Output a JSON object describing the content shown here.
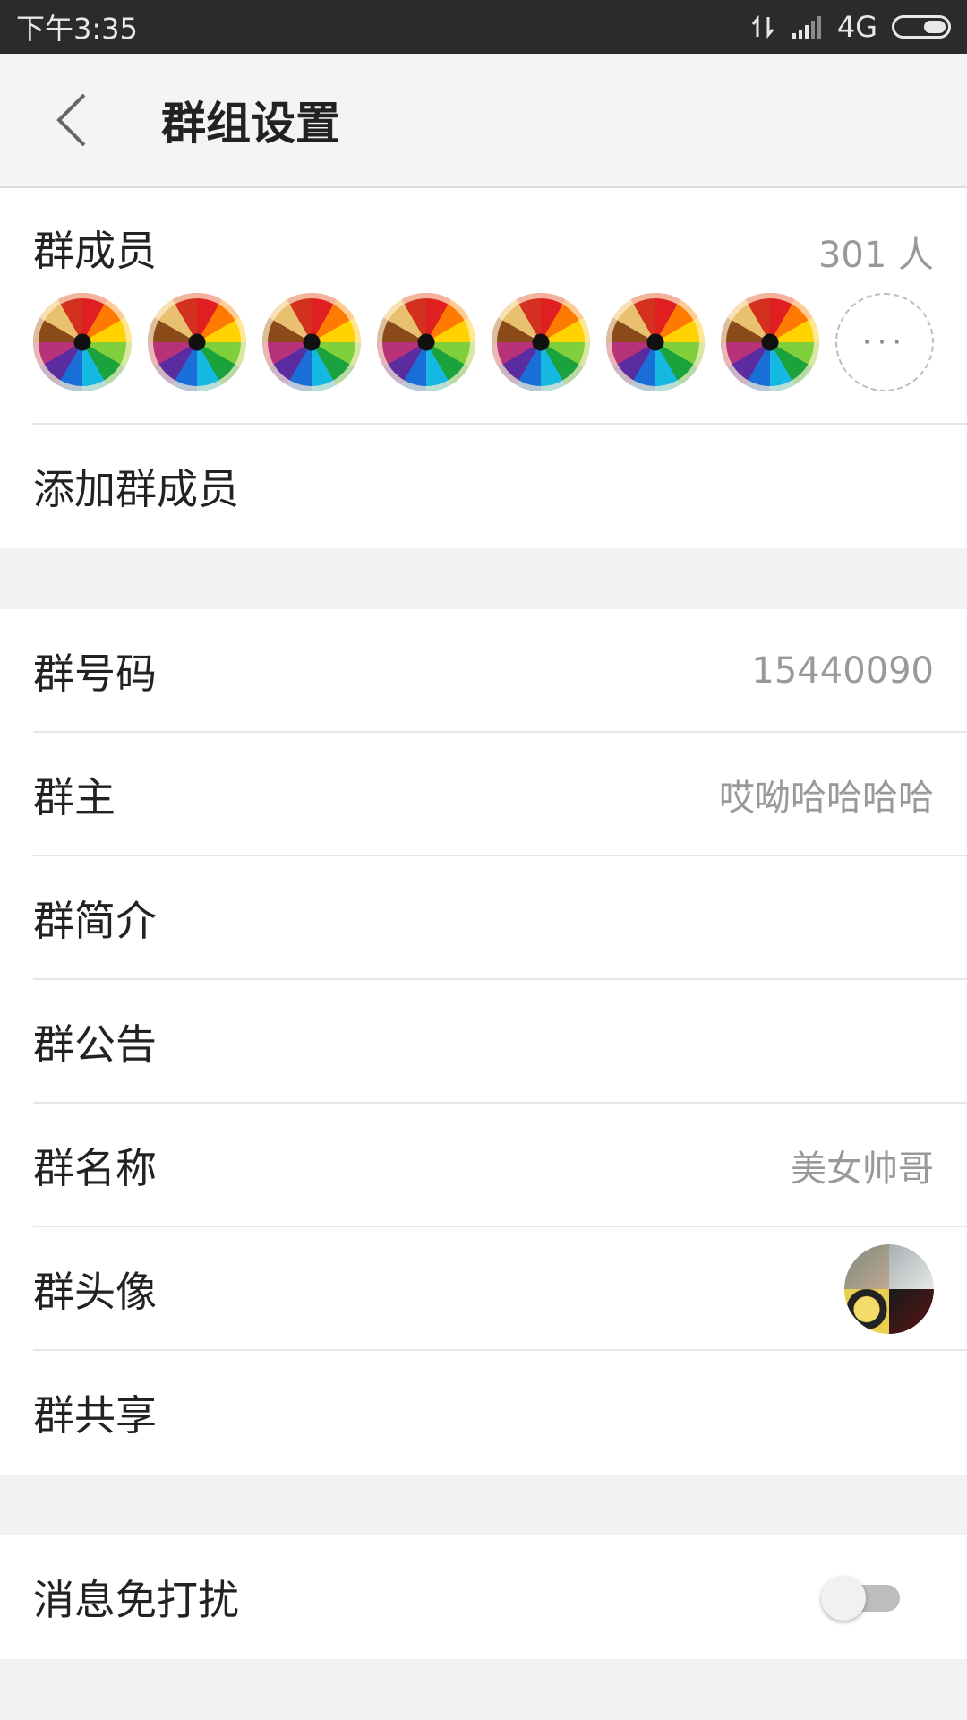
{
  "status_bar": {
    "time": "下午3:35",
    "network": "4G"
  },
  "header": {
    "title": "群组设置"
  },
  "members": {
    "label": "群成员",
    "count": "301 人",
    "avatar_count": 7,
    "more_label": "···"
  },
  "add_member": {
    "label": "添加群成员"
  },
  "info_rows": [
    {
      "label": "群号码",
      "value": "15440090"
    },
    {
      "label": "群主",
      "value": "哎呦哈哈哈哈"
    },
    {
      "label": "群简介",
      "value": ""
    },
    {
      "label": "群公告",
      "value": ""
    },
    {
      "label": "群名称",
      "value": "美女帅哥"
    },
    {
      "label": "群头像",
      "value": ""
    },
    {
      "label": "群共享",
      "value": ""
    }
  ],
  "dnd": {
    "label": "消息免打扰",
    "enabled": false
  },
  "colors": {
    "statusbar": "#2b2b2b",
    "background": "#f2f2f2",
    "text": "#222222",
    "secondary_text": "#999999"
  }
}
